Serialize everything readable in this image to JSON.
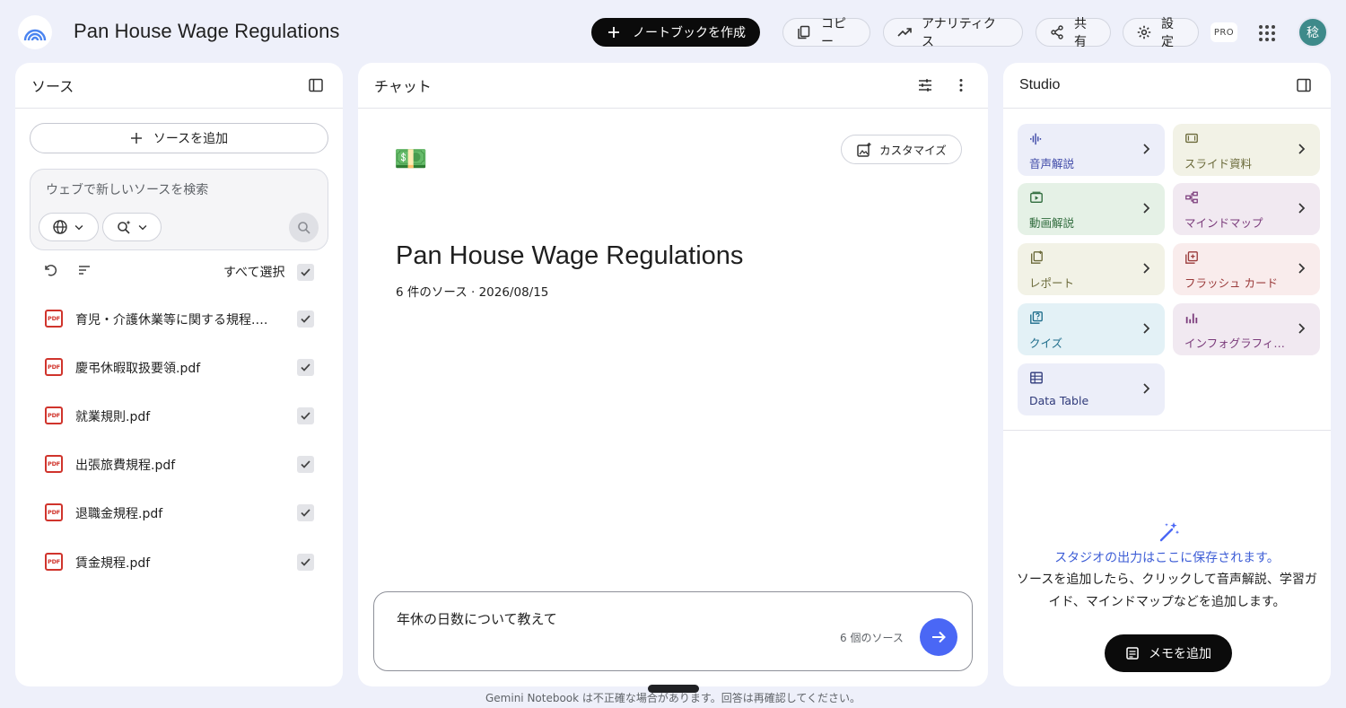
{
  "header": {
    "title": "Pan House Wage Regulations",
    "create_notebook": "ノートブックを作成",
    "copy": "コピー",
    "analytics": "アナリティクス",
    "share": "共有",
    "settings": "設定",
    "pro_badge": "PRO",
    "avatar_initial": "稔"
  },
  "sources": {
    "title": "ソース",
    "add_source": "ソースを追加",
    "search_placeholder": "ウェブで新しいソースを検索",
    "select_all": "すべて選択",
    "items": [
      {
        "name": "育児・介護休業等に関する規程.pdf",
        "type": "PDF",
        "checked": true
      },
      {
        "name": "慶弔休暇取扱要領.pdf",
        "type": "PDF",
        "checked": true
      },
      {
        "name": "就業規則.pdf",
        "type": "PDF",
        "checked": true
      },
      {
        "name": "出張旅費規程.pdf",
        "type": "PDF",
        "checked": true
      },
      {
        "name": "退職金規程.pdf",
        "type": "PDF",
        "checked": true
      },
      {
        "name": "賃金規程.pdf",
        "type": "PDF",
        "checked": true
      }
    ]
  },
  "chat": {
    "title": "チャット",
    "customize": "カスタマイズ",
    "emoji": "💵",
    "notebook_title": "Pan House Wage Regulations",
    "notebook_meta": "6 件のソース · 2026/08/15",
    "input_value": "年休の日数について教えて",
    "source_count": "6 個のソース"
  },
  "studio": {
    "title": "Studio",
    "tiles": [
      {
        "label": "音声解説",
        "icon": "audio-waveform-icon",
        "color": "#3f4aa8",
        "bg": "#eceef9"
      },
      {
        "label": "スライド資料",
        "icon": "slides-icon",
        "color": "#6b6a3a",
        "bg": "#f2f2e6"
      },
      {
        "label": "動画解説",
        "icon": "video-icon",
        "color": "#2f6b3c",
        "bg": "#e5f1e6"
      },
      {
        "label": "マインドマップ",
        "icon": "mindmap-icon",
        "color": "#7a3a7a",
        "bg": "#f1e9f1"
      },
      {
        "label": "レポート",
        "icon": "report-icon",
        "color": "#6b6a3a",
        "bg": "#f2f2e6"
      },
      {
        "label": "フラッシュ カード",
        "icon": "flashcard-icon",
        "color": "#9a3a3a",
        "bg": "#f9ecec"
      },
      {
        "label": "クイズ",
        "icon": "quiz-icon",
        "color": "#1d6c8a",
        "bg": "#e3f1f6"
      },
      {
        "label": "インフォグラフィック",
        "icon": "infographic-icon",
        "color": "#7a3a7a",
        "bg": "#f1e9f1"
      },
      {
        "label": "Data Table",
        "icon": "table-icon",
        "color": "#2f3a7a",
        "bg": "#eceef9"
      }
    ],
    "hint_title": "スタジオの出力はここに保存されます。",
    "hint_body": "ソースを追加したら、クリックして音声解説、学習ガイド、マインドマップなどを追加します。",
    "add_memo": "メモを追加"
  },
  "footer": {
    "disclaimer": "Gemini Notebook は不正確な場合があります。回答は再確認してください。"
  }
}
